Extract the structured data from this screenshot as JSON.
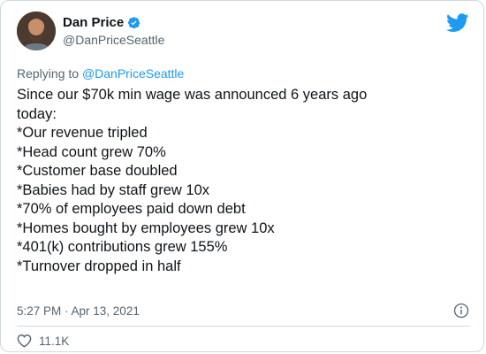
{
  "author": {
    "name": "Dan Price",
    "handle": "@DanPriceSeattle"
  },
  "reply": {
    "prefix": "Replying to ",
    "target": "@DanPriceSeattle"
  },
  "tweet": {
    "lines": [
      "Since our $70k min wage was announced 6 years ago",
      "today:",
      "*Our revenue tripled",
      "*Head count grew 70%",
      "*Customer base doubled",
      "*Babies had by staff grew 10x",
      "*70% of employees paid down debt",
      "*Homes bought by employees grew 10x",
      "*401(k) contributions grew 155%",
      "*Turnover dropped in half"
    ],
    "timestamp": "5:27 PM · Apr 13, 2021"
  },
  "engagement": {
    "likes": "11.1K"
  },
  "colors": {
    "accent": "#1d9bf0",
    "muted": "#536471",
    "text": "#0f1419"
  },
  "icons": {
    "verified": "verified-badge-icon",
    "brand": "twitter-bird-icon",
    "info": "info-icon",
    "like": "heart-icon"
  }
}
